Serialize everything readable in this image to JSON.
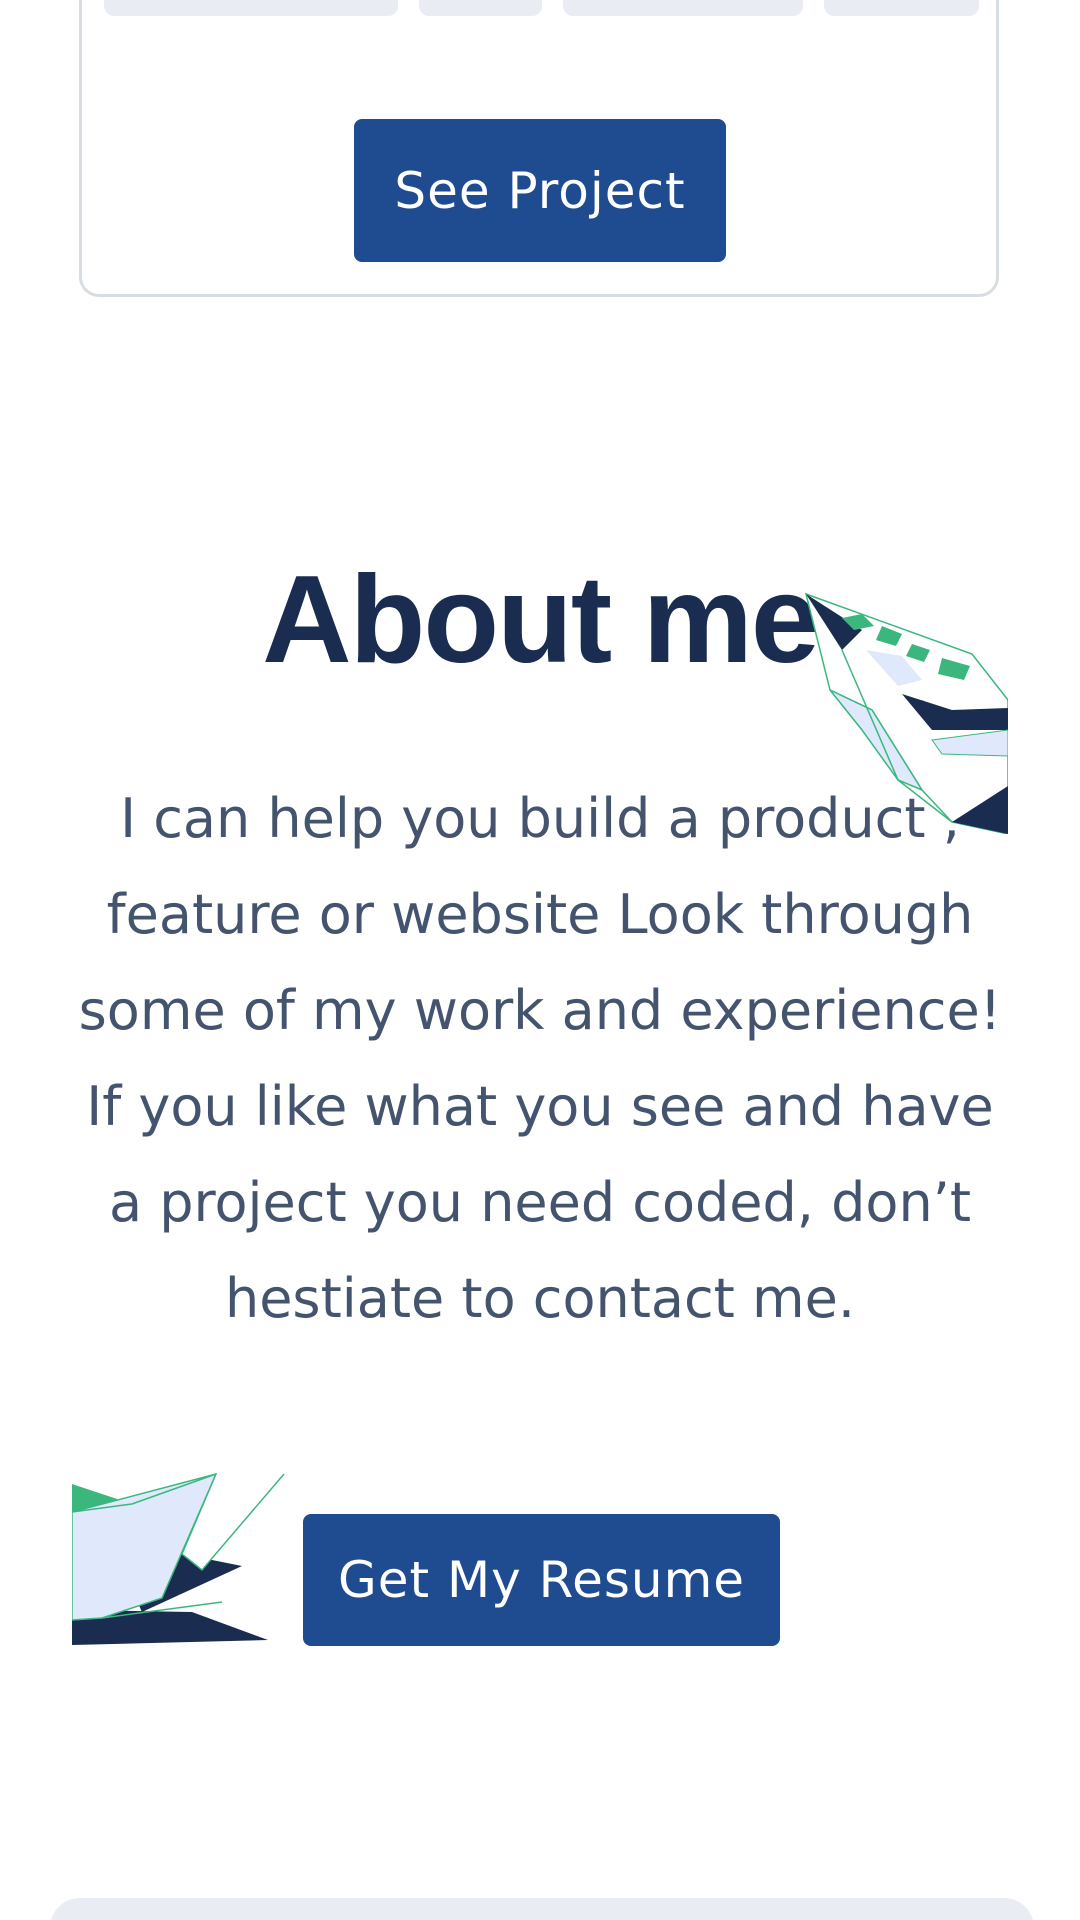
{
  "project_card": {
    "see_project_label": "See Project"
  },
  "about": {
    "title": "About me",
    "text": "I can help you build a product , feature or website Look through some of my work and experience! If you like what you see and have a project you need coded, don’t hestiate to contact me.",
    "resume_label": "Get My Resume"
  },
  "icons": {
    "top_decoration": "paper-plane-icon",
    "bottom_decoration": "paper-plane-icon"
  },
  "colors": {
    "button": "#1f4b91",
    "heading": "#1a2c50",
    "body_text": "#45546e",
    "accent_green": "#3bb77e",
    "accent_navy": "#1a2c50",
    "accent_light": "#dfe9fb"
  }
}
